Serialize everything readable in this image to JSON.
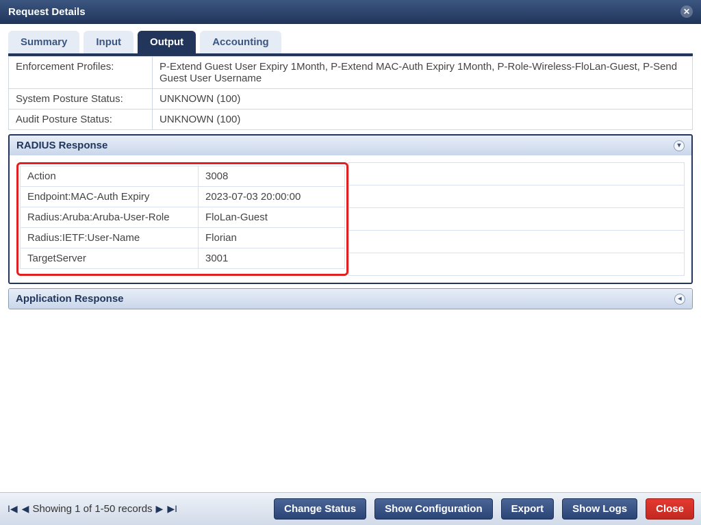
{
  "dialog": {
    "title": "Request Details"
  },
  "tabs": [
    {
      "label": "Summary"
    },
    {
      "label": "Input"
    },
    {
      "label": "Output",
      "active": true
    },
    {
      "label": "Accounting"
    }
  ],
  "summary": {
    "rows": [
      {
        "label": "Enforcement Profiles:",
        "value": "P-Extend Guest User Expiry 1Month, P-Extend MAC-Auth Expiry 1Month, P-Role-Wireless-FloLan-Guest, P-Send Guest User Username"
      },
      {
        "label": "System Posture Status:",
        "value": "UNKNOWN (100)"
      },
      {
        "label": "Audit Posture Status:",
        "value": "UNKNOWN (100)"
      }
    ]
  },
  "radius_panel": {
    "title": "RADIUS Response",
    "rows": [
      {
        "k": "Action",
        "v": "3008"
      },
      {
        "k": "Endpoint:MAC-Auth Expiry",
        "v": "2023-07-03 20:00:00"
      },
      {
        "k": "Radius:Aruba:Aruba-User-Role",
        "v": "FloLan-Guest"
      },
      {
        "k": "Radius:IETF:User-Name",
        "v": "Florian"
      },
      {
        "k": "TargetServer",
        "v": "3001"
      }
    ]
  },
  "app_panel": {
    "title": "Application Response"
  },
  "footer": {
    "pager": "Showing 1 of 1-50 records",
    "buttons": {
      "change_status": "Change Status",
      "show_config": "Show Configuration",
      "export": "Export",
      "show_logs": "Show Logs",
      "close": "Close"
    }
  }
}
